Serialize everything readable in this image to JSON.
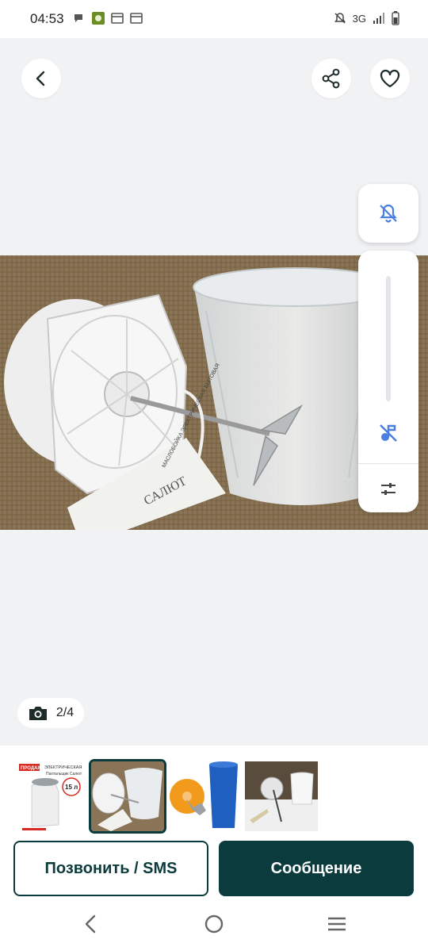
{
  "status_bar": {
    "time": "04:53",
    "network": "3G"
  },
  "viewer": {
    "back_icon": "chevron-left-icon",
    "share_icon": "share-icon",
    "favorite_icon": "heart-icon",
    "counter": "2/4"
  },
  "volume_panel": {
    "mute_icon": "bell-off-icon",
    "media_icon": "music-off-icon",
    "settings_icon": "sliders-icon"
  },
  "thumbnails": {
    "selected_index": 1,
    "items": [
      {
        "badge": "ПРОДАЖ",
        "title": "ЭЛЕКТРИЧЕСКАЯ",
        "subtitle": "Пахтальщик Салют",
        "volume": "15 л"
      },
      {},
      {},
      {},
      {}
    ]
  },
  "photo": {
    "label": "САЛЮТ",
    "booklet_text": "МАСЛОБОЙКА ЭЛЕКТРИЧЕСКАЯ БЫТОВАЯ"
  },
  "actions": {
    "call_label": "Позвонить / SMS",
    "message_label": "Сообщение"
  },
  "colors": {
    "accent": "#0b3b3c",
    "notification_blue": "#4a7fe0"
  }
}
